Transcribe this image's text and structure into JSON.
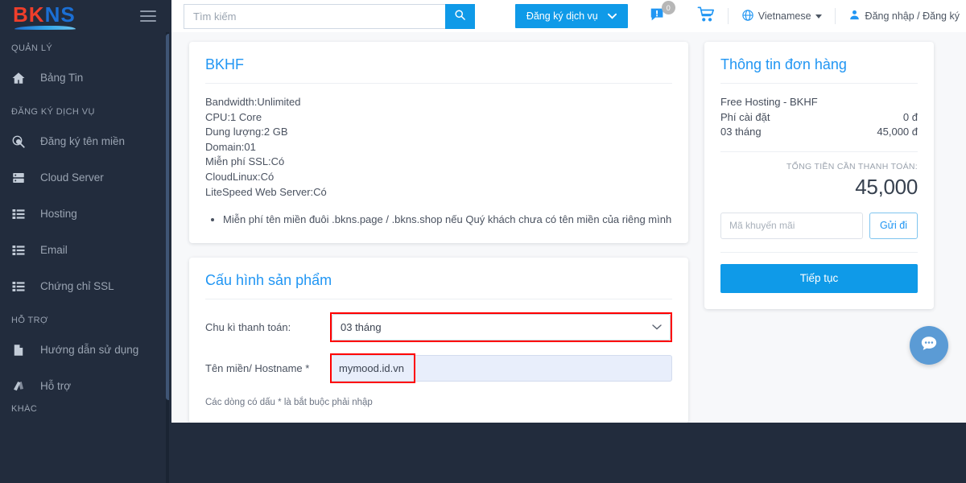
{
  "sidebar": {
    "logo": {
      "part1": "BK",
      "part2": "NS"
    },
    "sections": [
      {
        "title": "QUẢN LÝ",
        "items": [
          {
            "label": "Bảng Tin",
            "icon": "home-icon"
          }
        ]
      },
      {
        "title": "ĐĂNG KÝ DỊCH VỤ",
        "items": [
          {
            "label": "Đăng ký tên miền",
            "icon": "domain-search-icon"
          },
          {
            "label": "Cloud Server",
            "icon": "server-icon"
          },
          {
            "label": "Hosting",
            "icon": "list-icon"
          },
          {
            "label": "Email",
            "icon": "list-icon"
          },
          {
            "label": "Chứng chỉ SSL",
            "icon": "list-icon"
          }
        ]
      },
      {
        "title": "HỖ TRỢ",
        "items": [
          {
            "label": "Hướng dẫn sử dụng",
            "icon": "document-icon"
          },
          {
            "label": "Hỗ trợ",
            "icon": "support-icon"
          }
        ]
      },
      {
        "title": "KHÁC",
        "items": []
      }
    ]
  },
  "topbar": {
    "search_placeholder": "Tìm kiếm",
    "search_value": "",
    "register_service_label": "Đăng ký dịch vụ",
    "notification_count": "0",
    "language": "Vietnamese",
    "account": "Đăng nhập / Đăng ký"
  },
  "product": {
    "title": "BKHF",
    "specs": [
      "Bandwidth:Unlimited",
      "CPU:1 Core",
      "Dung lượng:2 GB",
      "Domain:01",
      "Miễn phí SSL:Có",
      "CloudLinux:Có",
      "LiteSpeed Web Server:Có"
    ],
    "bullets": [
      "Miễn phí tên miền đuôi .bkns.page / .bkns.shop nếu Quý khách chưa có tên miền của riêng mình"
    ]
  },
  "order": {
    "title": "Thông tin đơn hàng",
    "product_name": "Free Hosting - BKHF",
    "rows": [
      {
        "label": "Phí cài đặt",
        "value": "0 đ"
      },
      {
        "label": "03 tháng",
        "value": "45,000 đ"
      }
    ],
    "total_label": "TỔNG TIỀN CẦN THANH TOÁN:",
    "total_value": "45,000",
    "promo_placeholder": "Mã khuyến mãi",
    "promo_value": "",
    "promo_submit": "Gửi đi",
    "continue_label": "Tiếp tục"
  },
  "config": {
    "title": "Cấu hình sản phẩm",
    "billing_cycle_label": "Chu kì thanh toán:",
    "billing_cycle_value": "03 tháng",
    "hostname_label": "Tên miền/ Hostname *",
    "hostname_value": "mymood.id.vn",
    "note": "Các dòng có dấu * là bắt buộc phải nhập"
  },
  "colors": {
    "accent_blue": "#0f9ae8",
    "title_blue": "#2196f3",
    "sidebar_bg": "#222c3d",
    "highlight_red": "#ff0000",
    "logo_red": "#ef3e2b",
    "logo_blue": "#1b6fd4"
  }
}
